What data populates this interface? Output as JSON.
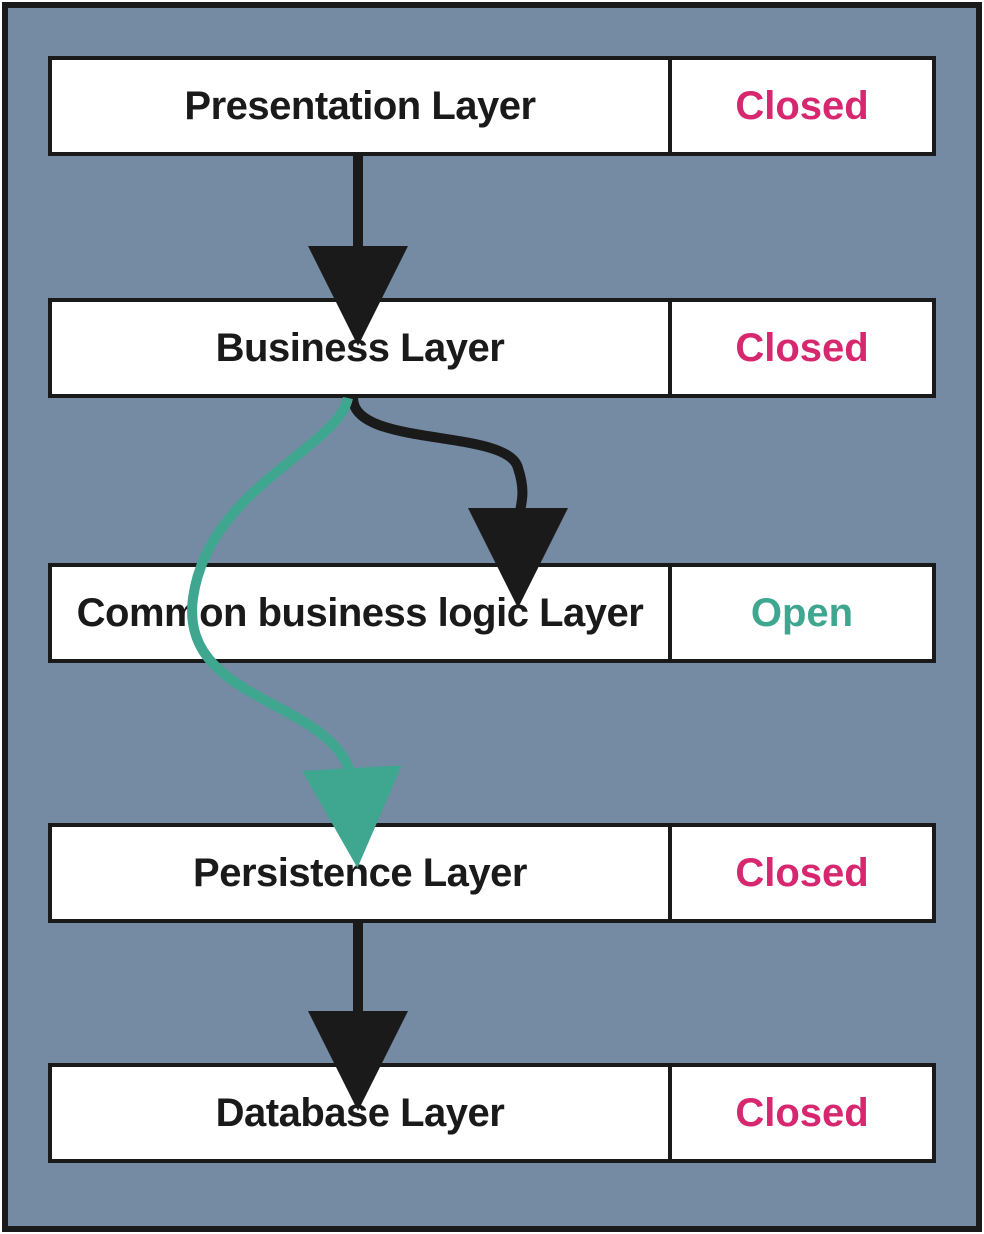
{
  "layers": [
    {
      "name": "Presentation Layer",
      "status": "Closed",
      "status_type": "closed"
    },
    {
      "name": "Business Layer",
      "status": "Closed",
      "status_type": "closed"
    },
    {
      "name": "Common business logic Layer",
      "status": "Open",
      "status_type": "open"
    },
    {
      "name": "Persistence Layer",
      "status": "Closed",
      "status_type": "closed"
    },
    {
      "name": "Database Layer",
      "status": "Closed",
      "status_type": "closed"
    }
  ],
  "arrows": [
    {
      "from": 0,
      "to": 1,
      "type": "straight",
      "color": "black"
    },
    {
      "from": 1,
      "to": 2,
      "type": "curved-right",
      "color": "black"
    },
    {
      "from": 1,
      "to": 3,
      "type": "curved-bypass",
      "color": "green"
    },
    {
      "from": 3,
      "to": 4,
      "type": "straight",
      "color": "black"
    }
  ],
  "colors": {
    "background": "#748ba3",
    "border": "#1a1a1a",
    "closed": "#d6276f",
    "open": "#3fa78f",
    "arrow_green": "#3fa78f",
    "arrow_black": "#1a1a1a"
  }
}
